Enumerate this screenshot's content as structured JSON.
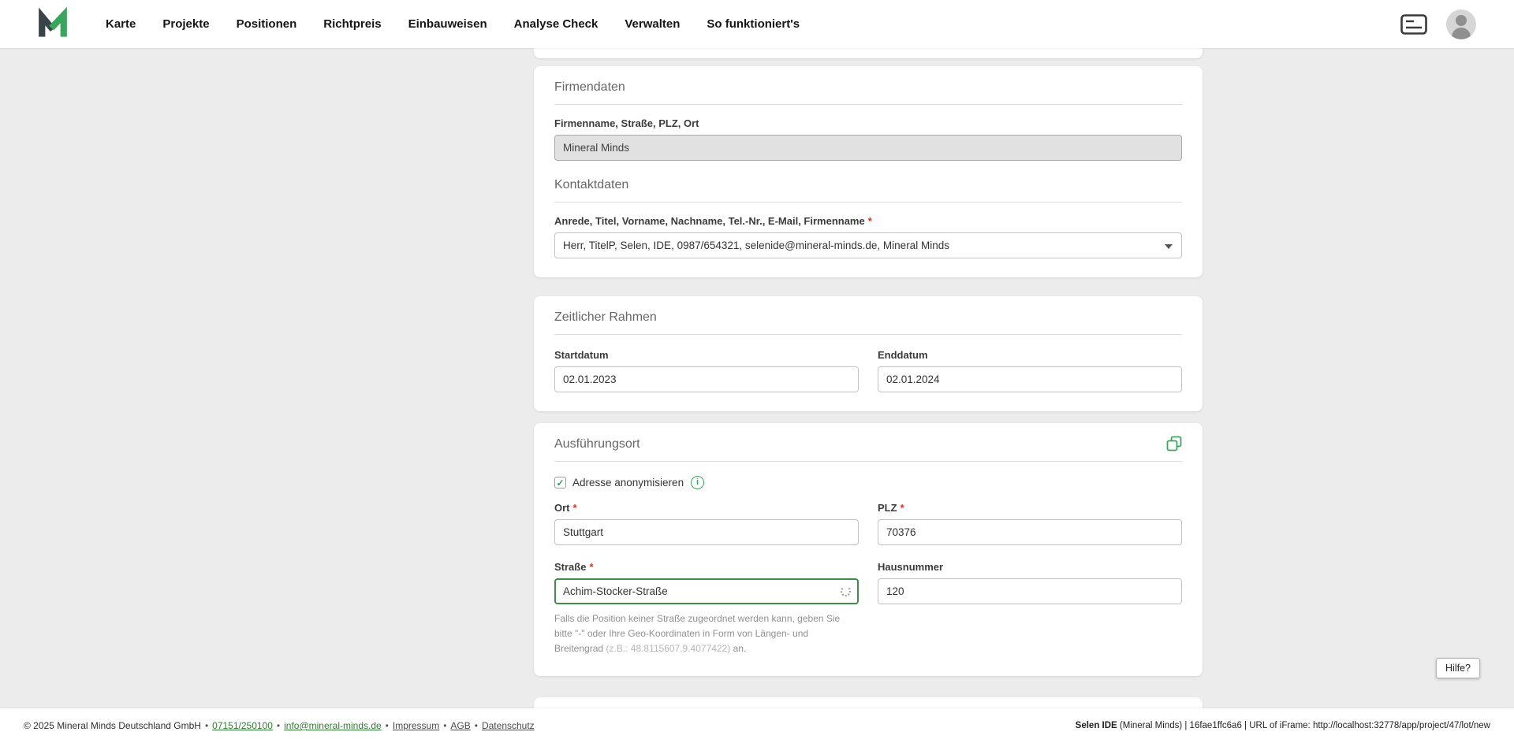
{
  "nav": {
    "items": [
      "Karte",
      "Projekte",
      "Positionen",
      "Richtpreis",
      "Einbauweisen",
      "Analyse Check",
      "Verwalten",
      "So funktioniert's"
    ]
  },
  "common": {
    "required": "*",
    "separator": "•"
  },
  "icons": {
    "check": "✓",
    "info": "i"
  },
  "colors": {
    "brand_green": "#3aa55d",
    "focus_green": "#3e8e49",
    "required_red": "#d93025"
  },
  "firmendaten": {
    "title": "Firmendaten",
    "company_label": "Firmenname, Straße, PLZ, Ort",
    "company_value": "Mineral Minds",
    "contact_title": "Kontaktdaten",
    "contact_label": "Anrede, Titel, Vorname, Nachname, Tel.-Nr., E-Mail, Firmenname",
    "contact_value": "Herr, TitelP, Selen, IDE, 0987/654321, selenide@mineral-minds.de, Mineral Minds"
  },
  "zeitraum": {
    "title": "Zeitlicher Rahmen",
    "start_label": "Startdatum",
    "start_value": "02.01.2023",
    "end_label": "Enddatum",
    "end_value": "02.01.2024"
  },
  "ausfuehrungsort": {
    "title": "Ausführungsort",
    "anonymize_label": "Adresse anonymisieren",
    "ort_label": "Ort",
    "ort_value": "Stuttgart",
    "plz_label": "PLZ",
    "plz_value": "70376",
    "strasse_label": "Straße",
    "strasse_value": "Achim-Stocker-Straße",
    "hausnummer_label": "Hausnummer",
    "hausnummer_value": "120",
    "helper_text": "Falls die Position keiner Straße zugeordnet werden kann, geben Sie bitte \"-\" oder Ihre Geo-Koordinaten in Form von Längen- und Breitengrad ",
    "helper_example": "(z.B.: 48.8115607,9.4077422)",
    "helper_suffix": " an."
  },
  "help_button": "Hilfe?",
  "footer": {
    "copyright": "© 2025 Mineral Minds Deutschland GmbH",
    "phone": "07151/250100",
    "email": "info@mineral-minds.de",
    "impressum": "Impressum",
    "agb": "AGB",
    "datenschutz": "Datenschutz",
    "right_app": "Selen IDE",
    "right_info": " (Mineral Minds) | 16fae1ffc6a6 | URL of iFrame: http://localhost:32778/app/project/47/lot/new"
  }
}
